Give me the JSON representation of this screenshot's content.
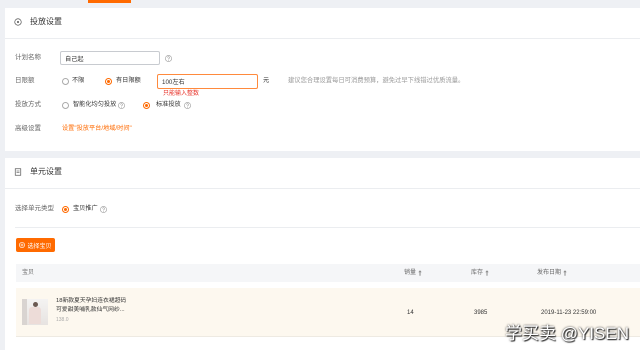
{
  "colors": {
    "accent": "#ff6a00",
    "error": "#e8332a",
    "page_background": "#eef0f4",
    "row_highlight": "#fdf8ef"
  },
  "delivery": {
    "title": "投放设置",
    "icon": "target-icon",
    "plan_name": {
      "label": "计划名称",
      "value": "自己起",
      "help_icon": "help-icon"
    },
    "daily_budget": {
      "label": "日限额",
      "options": [
        {
          "label": "不限",
          "selected": false
        },
        {
          "label": "有日限额",
          "selected": true
        }
      ],
      "value": "100左右",
      "unit": "元",
      "hint": "建议您合理设置每日可消费预算，避免过早下线错过优质流量。",
      "error": "只能输入整数"
    },
    "delivery_method": {
      "label": "投放方式",
      "options": [
        {
          "label": "智能化均匀投放",
          "selected": false
        },
        {
          "label": "标准投放",
          "selected": true
        }
      ]
    },
    "advanced": {
      "label": "高级设置",
      "link": "设置\"投放平台/地域/时间\""
    }
  },
  "unit": {
    "title": "单元设置",
    "icon": "document-icon",
    "unit_type": {
      "label": "选择单元类型",
      "option": "宝贝推广",
      "selected": true
    },
    "select_button": {
      "label": "选择宝贝",
      "icon": "plus-circle-icon"
    },
    "table": {
      "columns": [
        "宝贝",
        "销量",
        "库存",
        "发布日期"
      ],
      "sort_icon": "sort-up-icon",
      "rows": [
        {
          "title_line1": "18新款夏天孕妇连衣裙超码",
          "title_line2": "可爱甜美哺乳款仙气网纱...",
          "price": "138.0",
          "sales": "14",
          "stock": "3985",
          "date": "2019-11-23 22:59:00"
        }
      ]
    }
  },
  "watermark": "学买卖 @YISEN"
}
